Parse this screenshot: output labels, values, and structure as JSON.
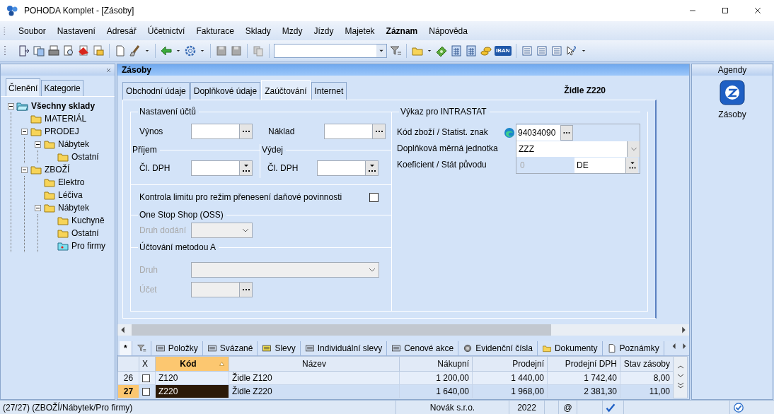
{
  "window": {
    "title": "POHODA Komplet - [Zásoby]"
  },
  "menu": [
    {
      "label": "Soubor",
      "bold": false
    },
    {
      "label": "Nastavení",
      "bold": false
    },
    {
      "label": "Adresář",
      "bold": false
    },
    {
      "label": "Účetnictví",
      "bold": false
    },
    {
      "label": "Fakturace",
      "bold": false
    },
    {
      "label": "Sklady",
      "bold": false
    },
    {
      "label": "Mzdy",
      "bold": false
    },
    {
      "label": "Jízdy",
      "bold": false
    },
    {
      "label": "Majetek",
      "bold": false
    },
    {
      "label": "Záznam",
      "bold": true
    },
    {
      "label": "Nápověda",
      "bold": false
    }
  ],
  "toolbar": {
    "iban_label": "IBAN"
  },
  "left_panel": {
    "tabs": [
      {
        "label": "Členění",
        "selected": true
      },
      {
        "label": "Kategorie",
        "selected": false
      }
    ],
    "tree": [
      {
        "label": "Všechny sklady",
        "kind": "root",
        "bold": true,
        "expanded": true,
        "children": [
          {
            "label": "MATERIÁL",
            "kind": "folder",
            "bold": false
          },
          {
            "label": "PRODEJ",
            "kind": "folder",
            "bold": false,
            "expanded": true,
            "children": [
              {
                "label": "Nábytek",
                "kind": "folder",
                "bold": false,
                "expanded": true,
                "children": [
                  {
                    "label": "Ostatní",
                    "kind": "folder",
                    "bold": false
                  }
                ]
              }
            ]
          },
          {
            "label": "ZBOŽÍ",
            "kind": "folder",
            "bold": false,
            "expanded": true,
            "children": [
              {
                "label": "Elektro",
                "kind": "folder",
                "bold": false
              },
              {
                "label": "Léčiva",
                "kind": "folder",
                "bold": false
              },
              {
                "label": "Nábytek",
                "kind": "folder",
                "bold": false,
                "expanded": true,
                "children": [
                  {
                    "label": "Kuchyně",
                    "kind": "folder",
                    "bold": false
                  },
                  {
                    "label": "Ostatní",
                    "kind": "folder",
                    "bold": false
                  },
                  {
                    "label": "Pro firmy",
                    "kind": "special",
                    "bold": false
                  }
                ]
              }
            ]
          }
        ]
      }
    ]
  },
  "agenda": {
    "title": "Zásoby",
    "record_title": "Židle Z220",
    "tabs": [
      {
        "label": "Obchodní údaje",
        "selected": false
      },
      {
        "label": "Doplňkové údaje",
        "selected": false
      },
      {
        "label": "Zaúčtování",
        "selected": true
      },
      {
        "label": "Internet",
        "selected": false
      }
    ],
    "accounts": {
      "legend": "Nastavení účtů",
      "fields": [
        {
          "label": "Výnos"
        },
        {
          "label": "Náklad"
        }
      ],
      "groups": [
        {
          "legend": "Příjem",
          "label": "Čl. DPH"
        },
        {
          "legend": "Výdej",
          "label": "Čl. DPH"
        }
      ]
    },
    "reverse_charge": {
      "label": "Kontrola limitu pro režim přenesení daňové povinnosti",
      "checked": false
    },
    "oss": {
      "legend": "One Stop Shop (OSS)",
      "fields": [
        {
          "label": "Druh dodání",
          "kind": "combo",
          "disabled": true
        }
      ]
    },
    "method_a": {
      "legend": "Účtování metodou A",
      "fields": [
        {
          "label": "Druh",
          "kind": "wide_combo",
          "disabled": true
        },
        {
          "label": "Účet",
          "kind": "lookup",
          "disabled": true
        }
      ]
    },
    "intrastat": {
      "legend": "Výkaz pro INTRASTAT",
      "rows": [
        {
          "label": "Kód zboží / Statist. znak",
          "kind": "code",
          "value": "94034090"
        },
        {
          "label": "Doplňková měrná jednotka",
          "kind": "combo",
          "value": "ZZZ"
        },
        {
          "label": "Koeficient / Stát původu",
          "kind": "pair",
          "value": "0",
          "value_2": "DE"
        }
      ]
    }
  },
  "detail_tabs": [
    {
      "label": "*",
      "kind": "text",
      "selected": true
    },
    {
      "kind": "filter",
      "selected": false
    },
    {
      "label": "Položky",
      "kind": "list",
      "selected": false
    },
    {
      "label": "Svázané",
      "kind": "list",
      "selected": false
    },
    {
      "label": "Slevy",
      "kind": "striped",
      "selected": false
    },
    {
      "label": "Individuální slevy",
      "kind": "list",
      "selected": false
    },
    {
      "label": "Cenové akce",
      "kind": "list",
      "selected": false
    },
    {
      "label": "Evidenční čísla",
      "kind": "disc",
      "selected": false
    },
    {
      "label": "Dokumenty",
      "kind": "folder",
      "selected": false
    },
    {
      "label": "Poznámky",
      "kind": "note",
      "selected": false
    }
  ],
  "grid": {
    "check_column": "X",
    "columns": [
      {
        "label": "Kód",
        "sorted": true
      },
      {
        "label": "Název",
        "sorted": false
      },
      {
        "label": "Nákupní",
        "sorted": false
      },
      {
        "label": "Prodejní",
        "sorted": false
      },
      {
        "label": "Prodejní DPH",
        "sorted": false
      },
      {
        "label": "Stav zásoby",
        "sorted": false
      }
    ],
    "rows": [
      {
        "number": "26",
        "selected": false,
        "checked": false,
        "cells": [
          "Z120",
          "Židle Z120",
          "1 200,00",
          "1 440,00",
          "1 742,40",
          "8,00"
        ]
      },
      {
        "number": "27",
        "selected": true,
        "checked": false,
        "cells": [
          "Z220",
          "Židle Z220",
          "1 640,00",
          "1 968,00",
          "2 381,30",
          "11,00"
        ]
      }
    ]
  },
  "status_bar": {
    "path": "(27/27) (ZBOŽÍ/Nábytek/Pro firmy)",
    "company": "Novák s.r.o.",
    "year": "2022",
    "mail": "@"
  },
  "agendas_panel": {
    "title": "Agendy",
    "items": [
      {
        "label": "Zásoby"
      }
    ]
  }
}
